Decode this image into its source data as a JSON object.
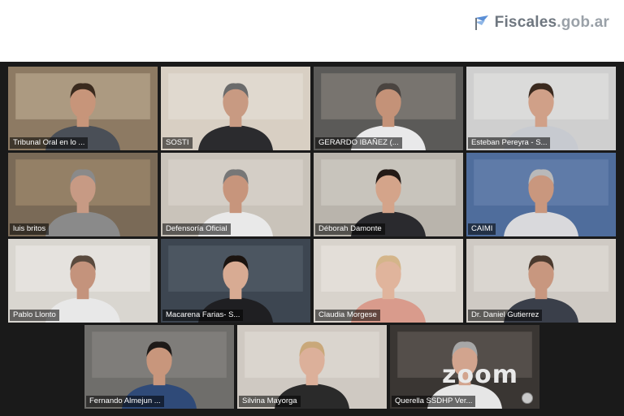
{
  "brand": {
    "name": "Fiscales",
    "domain": ".gob.ar"
  },
  "participants": [
    {
      "name": "Tribunal Oral en lo ...",
      "row": 0,
      "col": 0,
      "bg": "#8d7a63",
      "wall": "#c7b49a",
      "skin": "#c7957a",
      "shirt": "#4a4f57",
      "hair": "#3a2a1e"
    },
    {
      "name": "SOSTI",
      "row": 0,
      "col": 1,
      "bg": "#d8cfc3",
      "wall": "#e8e2d8",
      "skin": "#c89a82",
      "shirt": "#2b2b2e",
      "hair": "#6b6b6b"
    },
    {
      "name": "GERARDO IBAÑEZ (...",
      "row": 0,
      "col": 2,
      "bg": "#5b5a58",
      "wall": "#8f8b84",
      "skin": "#c49278",
      "shirt": "#e9e9ea",
      "hair": "#4a4440"
    },
    {
      "name": "Esteban Pereyra - S...",
      "row": 0,
      "col": 3,
      "bg": "#cfcfcf",
      "wall": "#e6e6e4",
      "skin": "#d0a088",
      "shirt": "#c7cad0",
      "hair": "#3b2a1f"
    },
    {
      "name": "luis britos",
      "row": 1,
      "col": 0,
      "bg": "#7a6a57",
      "wall": "#a99273",
      "skin": "#c79a84",
      "shirt": "#8a8a8a",
      "hair": "#8a8a8a"
    },
    {
      "name": "Defensoría Oficial",
      "row": 1,
      "col": 1,
      "bg": "#c9c3ba",
      "wall": "#dcd7cf",
      "skin": "#c7957c",
      "shirt": "#e9e9e9",
      "hair": "#777"
    },
    {
      "name": "Déborah Damonte",
      "row": 1,
      "col": 2,
      "bg": "#b9b4ac",
      "wall": "#d6d2cb",
      "skin": "#d4a48a",
      "shirt": "#2a2a2e",
      "hair": "#241a16",
      "speaking": true
    },
    {
      "name": "CAIMI",
      "row": 1,
      "col": 3,
      "bg": "#4f6d9c",
      "wall": "#6e86b3",
      "skin": "#c9977e",
      "shirt": "#d9d9dc",
      "hair": "#b9b9b9"
    },
    {
      "name": "Pablo Llonto",
      "row": 2,
      "col": 0,
      "bg": "#d9d6d0",
      "wall": "#efede9",
      "skin": "#c4937c",
      "shirt": "#e8e8e8",
      "hair": "#5a4a3e"
    },
    {
      "name": "Macarena Farias- S...",
      "row": 2,
      "col": 1,
      "bg": "#3d4651",
      "wall": "#5a6470",
      "skin": "#d8ab93",
      "shirt": "#1f1f22",
      "hair": "#1b1410"
    },
    {
      "name": "Claudia Morgese",
      "row": 2,
      "col": 2,
      "bg": "#d8d3cc",
      "wall": "#ece8e2",
      "skin": "#e0b49c",
      "shirt": "#d99b8c",
      "hair": "#d4b58a"
    },
    {
      "name": "Dr. Daniel Gutierrez",
      "row": 2,
      "col": 3,
      "bg": "#cfcac4",
      "wall": "#e4e0db",
      "skin": "#c8977f",
      "shirt": "#3a3f4a",
      "hair": "#4b3a2e"
    },
    {
      "name": "Fernando Almejun ...",
      "row": 3,
      "col": 0,
      "bg": "#6f6e6b",
      "wall": "#8c8a86",
      "skin": "#c8967c",
      "shirt": "#2f4a78",
      "hair": "#1e1a18"
    },
    {
      "name": "Silvina Mayorga",
      "row": 3,
      "col": 1,
      "bg": "#cfc9c2",
      "wall": "#e4dfd9",
      "skin": "#dcb09a",
      "shirt": "#2a2a2a",
      "hair": "#c9a87a"
    },
    {
      "name": "Querella SSDHP Ver...",
      "row": 3,
      "col": 2,
      "bg": "#3a3633",
      "wall": "#6a635c",
      "skin": "#d2a48e",
      "shirt": "#e6e6e6",
      "hair": "#a7a7a7"
    }
  ],
  "watermark": "zoom"
}
